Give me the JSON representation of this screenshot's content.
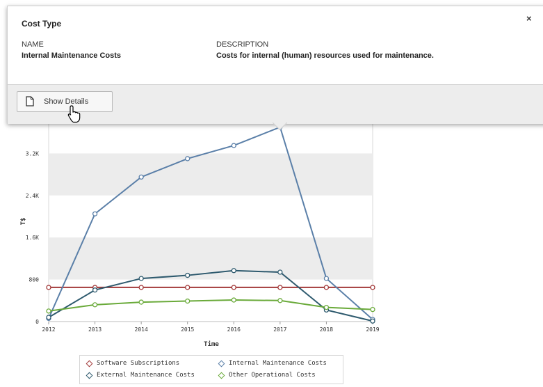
{
  "popover": {
    "title": "Cost Type",
    "close_label": "×",
    "name_label": "NAME",
    "name_value": "Internal Maintenance Costs",
    "description_label": "DESCRIPTION",
    "description_value": "Costs for internal (human) resources used for maintenance.",
    "details_button": "Show Details",
    "details_icon": "document-icon"
  },
  "chart_data": {
    "type": "line",
    "x": [
      2012,
      2013,
      2014,
      2015,
      2016,
      2017,
      2018,
      2019
    ],
    "xlabel": "Time",
    "ylabel": "T$",
    "ylim": [
      0,
      4000
    ],
    "y_ticks": [
      "0",
      "800",
      "1.6K",
      "2.4K",
      "3.2K"
    ],
    "grid": "alternating horizontal bands",
    "legend_position": "bottom",
    "series": [
      {
        "name": "Software Subscriptions",
        "color": "#a33a3a",
        "values": [
          650,
          650,
          650,
          650,
          650,
          650,
          650,
          650
        ]
      },
      {
        "name": "Internal Maintenance Costs",
        "color": "#5a7fa8",
        "values": [
          60,
          2050,
          2750,
          3100,
          3350,
          3700,
          820,
          40
        ]
      },
      {
        "name": "External Maintenance Costs",
        "color": "#2e5a6e",
        "values": [
          80,
          600,
          820,
          880,
          970,
          940,
          220,
          10
        ]
      },
      {
        "name": "Other Operational Costs",
        "color": "#6aaa3a",
        "values": [
          200,
          320,
          370,
          390,
          410,
          400,
          270,
          230
        ]
      }
    ]
  }
}
